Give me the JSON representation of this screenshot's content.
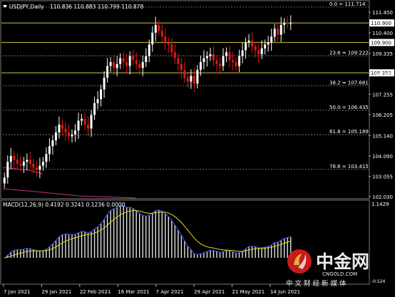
{
  "header": {
    "symbol": "USDJPY,Daily",
    "ohlc": "110.836 110.883 110.799 110.878",
    "macd_label": "MACD(12,26,9) 0.4192 0.3241 0.1236 0.0000"
  },
  "price_axis": {
    "ticks": [
      "111.450",
      "110.400",
      "109.335",
      "108.305",
      "107.255",
      "106.205",
      "105.140",
      "104.090",
      "103.055",
      "102.030"
    ],
    "tick_values": [
      111.45,
      110.4,
      109.335,
      108.305,
      107.255,
      106.205,
      105.14,
      104.09,
      103.055,
      102.03
    ],
    "range": [
      101.95,
      112.0
    ]
  },
  "macd_axis": {
    "top": "1.1429",
    "bottom": "-0.524"
  },
  "date_axis": [
    "7 Jan 2021",
    "29 Jan 2021",
    "22 Feb 2021",
    "16 Mar 2021",
    "7 Apr 2021",
    "29 Apr 2021",
    "21 May 2021",
    "14 Jun 2021"
  ],
  "levels": [
    {
      "label": "110.900",
      "value": 110.9,
      "color": "#d4c43a",
      "style": "box"
    },
    {
      "label": "109.900",
      "value": 109.9,
      "color": "#d4c43a",
      "style": "box"
    },
    {
      "label": "108.350",
      "value": 108.35,
      "color": "#d4c43a",
      "style": "box"
    }
  ],
  "fibonacci": [
    {
      "label": "0.0 = 111.714",
      "value": 111.714
    },
    {
      "label": "23.6 = 109.222",
      "value": 109.222
    },
    {
      "label": "38.2 = 107.681",
      "value": 107.681
    },
    {
      "label": "50.0 = 106.435",
      "value": 106.435
    },
    {
      "label": "61.8 = 105.189",
      "value": 105.189
    },
    {
      "label": "78.6 = 103.415",
      "value": 103.415
    }
  ],
  "watermark": {
    "chinese": "中金网",
    "english": "CNGOLD.COM",
    "subtitle": "中文财经新媒体"
  },
  "colors": {
    "up": "#ffffff",
    "down": "#e01818",
    "macd_main": "#3b5bff",
    "macd_signal": "#e8d81a",
    "ma_line": "#c0308a",
    "level": "#d4c43a",
    "fib": "#888888"
  },
  "chart_data": {
    "type": "candlestick",
    "title": "USDJPY,Daily",
    "ylim": [
      101.95,
      112.0
    ],
    "close_series_approx": [
      103.0,
      103.8,
      104.1,
      103.9,
      103.7,
      103.6,
      103.8,
      103.9,
      103.7,
      103.5,
      103.4,
      103.6,
      103.8,
      104.2,
      104.6,
      104.9,
      105.3,
      105.7,
      105.5,
      105.3,
      105.1,
      105.2,
      105.4,
      105.9,
      106.0,
      105.7,
      105.5,
      106.2,
      106.8,
      107.0,
      107.5,
      108.1,
      108.7,
      108.9,
      108.6,
      108.8,
      109.1,
      108.9,
      108.7,
      109.2,
      109.0,
      108.8,
      108.6,
      108.9,
      109.2,
      109.8,
      110.4,
      110.8,
      110.5,
      110.2,
      109.9,
      109.8,
      109.4,
      109.1,
      108.8,
      108.5,
      108.1,
      107.9,
      108.2,
      107.8,
      108.5,
      108.9,
      109.1,
      109.2,
      109.3,
      109.0,
      108.8,
      108.7,
      109.2,
      109.4,
      109.0,
      108.9,
      108.7,
      109.2,
      109.5,
      109.9,
      110.0,
      109.7,
      109.5,
      109.3,
      109.6,
      109.8,
      109.9,
      110.2,
      110.6,
      110.3,
      110.8,
      110.9,
      110.85,
      110.88
    ],
    "macd_range": [
      -0.524,
      1.1429
    ]
  }
}
